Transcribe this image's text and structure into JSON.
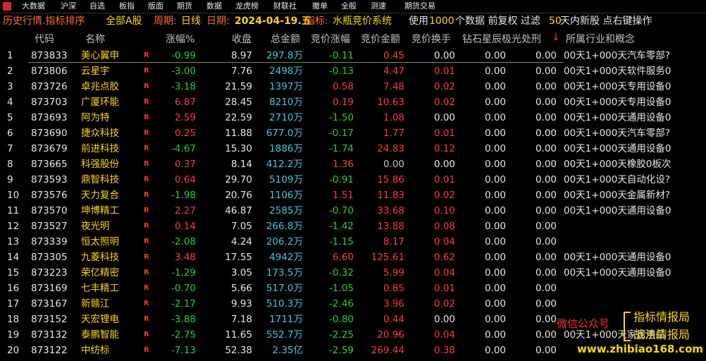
{
  "menu": [
    "大数据",
    "沪深",
    "自选",
    "板指",
    "版面",
    "期货",
    "数据",
    "龙虎榜",
    "财联社",
    "撤单",
    "全般",
    "测速",
    "期货交易"
  ],
  "toolbar": {
    "title": "历史行情.指标排序",
    "market": "全部A股",
    "period_label": "周期:",
    "period_value": "日线",
    "date_label": "日期:",
    "date_value": "2024-04-19.五",
    "indicator_label": "指标:",
    "indicator_value": "水瓶竞价系统",
    "use_prefix": "使用",
    "use_count": "1000",
    "use_suffix": "个数据 前复权 过滤",
    "filter_days": "50",
    "filter_suffix": "天内新股 点右键操作"
  },
  "headers": {
    "code": "代码",
    "name": "名称",
    "change": "涨幅%",
    "close": "收盘",
    "amount": "总金额",
    "bid_change": "竞价涨幅",
    "bid_amount": "竞价金额",
    "bid_turnover": "竞价换手",
    "signal": "钻石星辰极光处刑",
    "sort_arrow": "↓",
    "industry": "所属行业和概念"
  },
  "rows": [
    {
      "idx": "1",
      "code": "873833",
      "name": "美心翼申",
      "flag": "R",
      "change": "-0.99",
      "close": "8.97",
      "amount": "297.8万",
      "bid_change": "-0.11",
      "bid_amount": "0.45",
      "bid_turnover": "0.00",
      "s1": "0.00",
      "s2": "0.00",
      "industry": "00天1+000天汽车零部?"
    },
    {
      "idx": "2",
      "code": "873806",
      "name": "云星宇",
      "flag": "R",
      "change": "-3.00",
      "close": "7.76",
      "amount": "2498万",
      "bid_change": "-0.13",
      "bid_amount": "4.47",
      "bid_turnover": "0.01",
      "s1": "0.00",
      "s2": "0.00",
      "industry": "00天1+000天软件服务0"
    },
    {
      "idx": "3",
      "code": "873726",
      "name": "卓兆点胶",
      "flag": "R",
      "change": "-3.18",
      "close": "21.59",
      "amount": "1397万",
      "bid_change": "0.58",
      "bid_amount": "7.48",
      "bid_turnover": "0.02",
      "s1": "0.00",
      "s2": "0.00",
      "industry": "00天1+000天专用设备0"
    },
    {
      "idx": "4",
      "code": "873703",
      "name": "广厦环能",
      "flag": "R",
      "change": "6.87",
      "close": "28.45",
      "amount": "8210万",
      "bid_change": "0.19",
      "bid_amount": "10.63",
      "bid_turnover": "0.02",
      "s1": "0.00",
      "s2": "0.00",
      "industry": "00天1+000天专用设备0"
    },
    {
      "idx": "5",
      "code": "873693",
      "name": "阿为特",
      "flag": "R",
      "change": "2.59",
      "close": "22.59",
      "amount": "2710万",
      "bid_change": "-1.50",
      "bid_amount": "1.08",
      "bid_turnover": "0.00",
      "s1": "0.00",
      "s2": "0.00",
      "industry": "00天1+000天通用设备0"
    },
    {
      "idx": "6",
      "code": "873690",
      "name": "捷众科技",
      "flag": "R",
      "change": "0.25",
      "close": "11.88",
      "amount": "677.0万",
      "bid_change": "-0.17",
      "bid_amount": "1.77",
      "bid_turnover": "0.01",
      "s1": "0.00",
      "s2": "0.00",
      "industry": "00天1+000天汽车零部?"
    },
    {
      "idx": "7",
      "code": "873679",
      "name": "前进科技",
      "flag": "R",
      "change": "-4.67",
      "close": "15.30",
      "amount": "1886万",
      "bid_change": "-1.74",
      "bid_amount": "24.83",
      "bid_turnover": "0.12",
      "s1": "0.00",
      "s2": "0.00",
      "industry": "00天1+000天通用设备0"
    },
    {
      "idx": "8",
      "code": "873665",
      "name": "科强股份",
      "flag": "R",
      "change": "0.37",
      "close": "8.14",
      "amount": "412.2万",
      "bid_change": "1.36",
      "bid_amount": "0.00",
      "bid_turnover": "0.00",
      "s1": "0.00",
      "s2": "0.00",
      "industry": "00天1+000天橡胶0板次"
    },
    {
      "idx": "9",
      "code": "873593",
      "name": "鼎智科技",
      "flag": "R",
      "change": "0.64",
      "close": "29.70",
      "amount": "5109万",
      "bid_change": "-0.91",
      "bid_amount": "15.86",
      "bid_turnover": "0.01",
      "s1": "0.00",
      "s2": "0.00",
      "industry": "00天1+000天自动化设?"
    },
    {
      "idx": "10",
      "code": "873576",
      "name": "天力复合",
      "flag": "R",
      "change": "-1.98",
      "close": "20.76",
      "amount": "1106万",
      "bid_change": "1.51",
      "bid_amount": "11.83",
      "bid_turnover": "0.02",
      "s1": "0.00",
      "s2": "0.00",
      "industry": "00天1+000天金属新材?"
    },
    {
      "idx": "11",
      "code": "873570",
      "name": "坤博精工",
      "flag": "R",
      "change": "2.27",
      "close": "46.87",
      "amount": "2585万",
      "bid_change": "-0.70",
      "bid_amount": "33.68",
      "bid_turnover": "0.10",
      "s1": "0.00",
      "s2": "0.00",
      "industry": "00天1+000天通用设备0"
    },
    {
      "idx": "12",
      "code": "873527",
      "name": "夜光明",
      "flag": "R",
      "change": "0.14",
      "close": "7.05",
      "amount": "266.8万",
      "bid_change": "-1.42",
      "bid_amount": "13.88",
      "bid_turnover": "0.08",
      "s1": "0.00",
      "s2": "0.00",
      "industry": ""
    },
    {
      "idx": "13",
      "code": "873339",
      "name": "恒太照明",
      "flag": "R",
      "change": "-2.08",
      "close": "4.24",
      "amount": "206.2万",
      "bid_change": "-1.15",
      "bid_amount": "8.17",
      "bid_turnover": "0.04",
      "s1": "0.00",
      "s2": "0.00",
      "industry": ""
    },
    {
      "idx": "14",
      "code": "873305",
      "name": "九菱科技",
      "flag": "R",
      "change": "3.48",
      "close": "17.55",
      "amount": "4942万",
      "bid_change": "6.60",
      "bid_amount": "125.61",
      "bid_turnover": "0.62",
      "s1": "0.00",
      "s2": "0.00",
      "industry": "00天1+000天通用设备0"
    },
    {
      "idx": "15",
      "code": "873223",
      "name": "荣亿精密",
      "flag": "R",
      "change": "-1.29",
      "close": "3.05",
      "amount": "173.5万",
      "bid_change": "-0.32",
      "bid_amount": "5.99",
      "bid_turnover": "0.04",
      "s1": "0.00",
      "s2": "0.00",
      "industry": "00天1+000天通用设备0"
    },
    {
      "idx": "16",
      "code": "873169",
      "name": "七丰精工",
      "flag": "R",
      "change": "-0.70",
      "close": "5.66",
      "amount": "517.0万",
      "bid_change": "-1.05",
      "bid_amount": "0.85",
      "bid_turnover": "0.01",
      "s1": "0.00",
      "s2": "0.00",
      "industry": ""
    },
    {
      "idx": "17",
      "code": "873167",
      "name": "新赣江",
      "flag": "R",
      "change": "-2.17",
      "close": "9.93",
      "amount": "510.3万",
      "bid_change": "-2.46",
      "bid_amount": "3.96",
      "bid_turnover": "0.02",
      "s1": "0.00",
      "s2": "0.00",
      "industry": ""
    },
    {
      "idx": "18",
      "code": "873152",
      "name": "天宏锂电",
      "flag": "R",
      "change": "-3.88",
      "close": "7.18",
      "amount": "1711万",
      "bid_change": "-0.80",
      "bid_amount": "0.44",
      "bid_turnover": "0.00",
      "s1": "0.00",
      "s2": "0.00",
      "industry": ""
    },
    {
      "idx": "19",
      "code": "873132",
      "name": "泰鹏智能",
      "flag": "R",
      "change": "-2.75",
      "close": "11.65",
      "amount": "552.7万",
      "bid_change": "-2.25",
      "bid_amount": "20.96",
      "bid_turnover": "0.04",
      "s1": "0.00",
      "s2": "0.00",
      "industry": "00天1+000天家居用品"
    },
    {
      "idx": "20",
      "code": "873122",
      "name": "中纺标",
      "flag": "R",
      "change": "-7.13",
      "close": "52.38",
      "amount": "2.35亿",
      "bid_change": "-2.59",
      "bid_amount": "269.44",
      "bid_turnover": "0.38",
      "s1": "0.00",
      "s2": "0.00",
      "industry": ""
    }
  ],
  "watermark": {
    "wechat": "微信公众号",
    "line1": "指标情报局",
    "line2": "战法情报局",
    "url": "www.zhibiao168.com"
  },
  "colors": {
    "up": "#ff3a3a",
    "down": "#22d422",
    "amount": "#40c8e0",
    "label": "#ff5a2a",
    "value": "#ffd700"
  }
}
